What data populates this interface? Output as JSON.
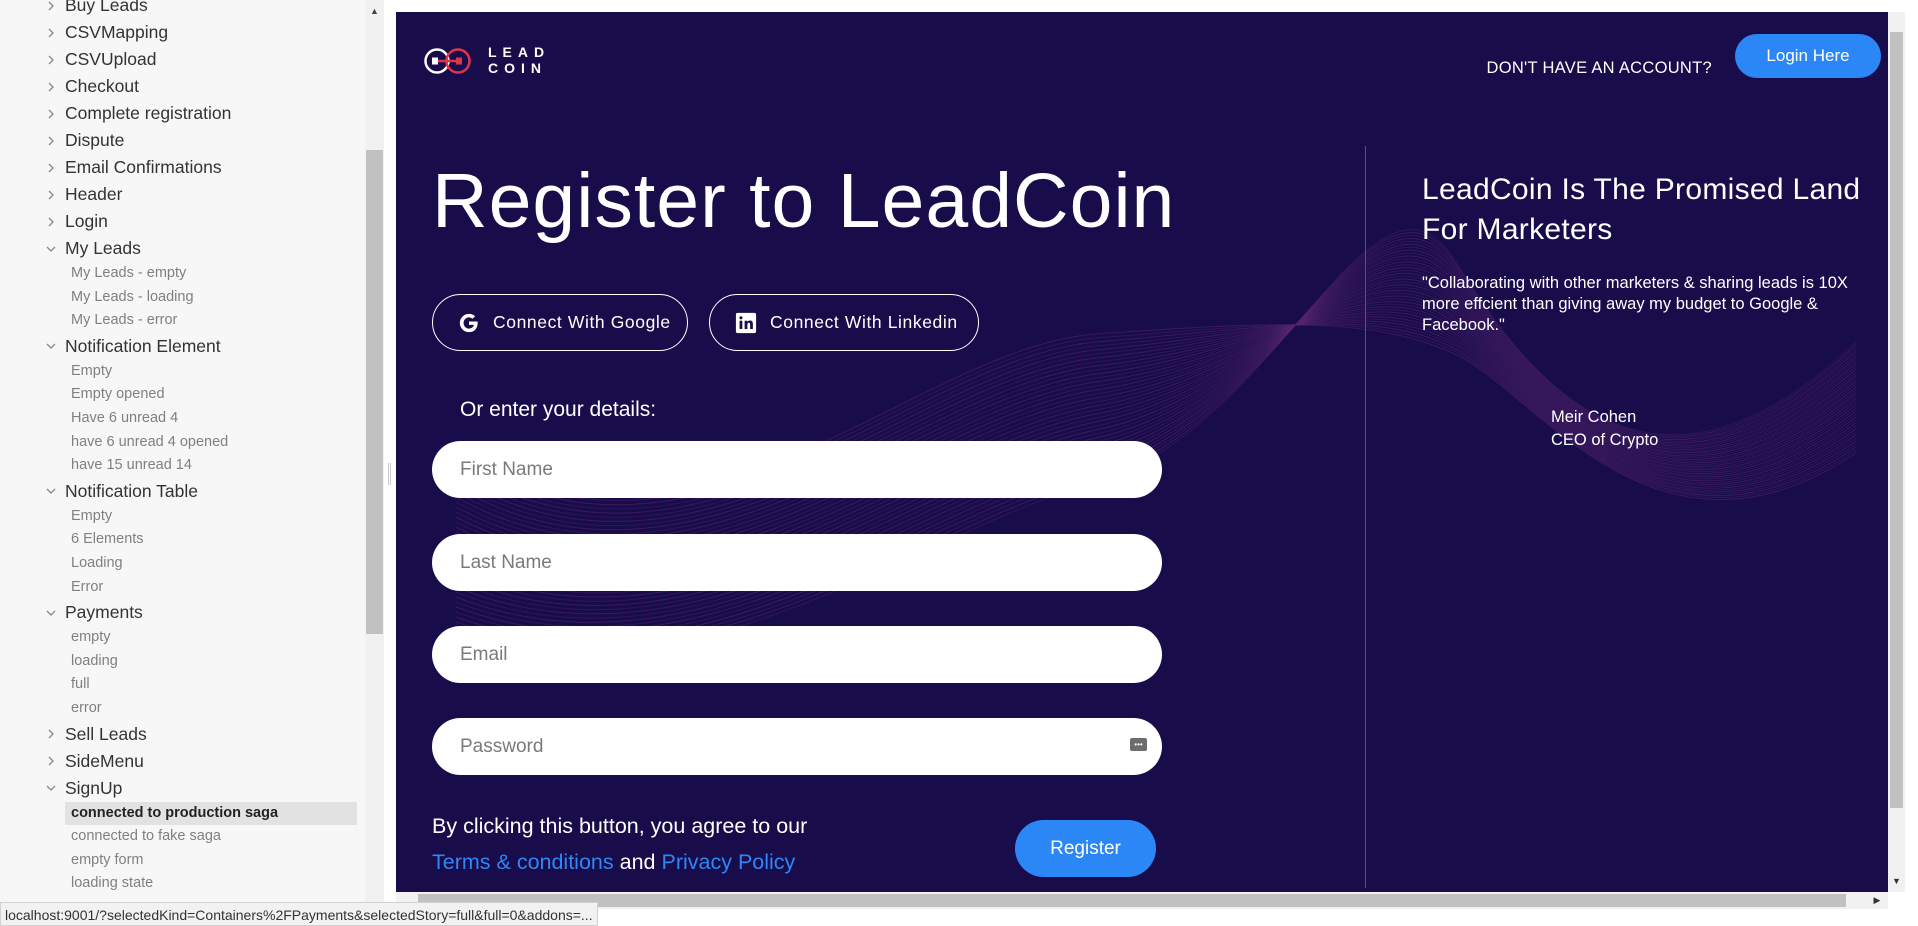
{
  "sidebar": {
    "tree": [
      {
        "label": "Buy Leads",
        "expanded": false
      },
      {
        "label": "CSVMapping",
        "expanded": false
      },
      {
        "label": "CSVUpload",
        "expanded": false
      },
      {
        "label": "Checkout",
        "expanded": false
      },
      {
        "label": "Complete registration",
        "expanded": false
      },
      {
        "label": "Dispute",
        "expanded": false
      },
      {
        "label": "Email Confirmations",
        "expanded": false
      },
      {
        "label": "Header",
        "expanded": false
      },
      {
        "label": "Login",
        "expanded": false
      },
      {
        "label": "My Leads",
        "expanded": true,
        "stories": [
          "My Leads - empty",
          "My Leads - loading",
          "My Leads - error"
        ]
      },
      {
        "label": "Notification Element",
        "expanded": true,
        "stories": [
          "Empty",
          "Empty opened",
          "Have 6 unread 4",
          "have 6 unread 4 opened",
          "have 15 unread 14"
        ]
      },
      {
        "label": "Notification Table",
        "expanded": true,
        "stories": [
          "Empty",
          "6 Elements",
          "Loading",
          "Error"
        ]
      },
      {
        "label": "Payments",
        "expanded": true,
        "stories": [
          "empty",
          "loading",
          "full",
          "error"
        ]
      },
      {
        "label": "Sell Leads",
        "expanded": false
      },
      {
        "label": "SideMenu",
        "expanded": false
      },
      {
        "label": "SignUp",
        "expanded": true,
        "stories": [
          "connected to production saga",
          "connected to fake saga",
          "empty form",
          "loading state"
        ],
        "selected": "connected to production saga"
      }
    ]
  },
  "header": {
    "logo_text_line1": "LEAD",
    "logo_text_line2": "COIN",
    "no_account": "DON'T HAVE AN ACCOUNT?",
    "login_label": "Login Here"
  },
  "register": {
    "title": "Register to LeadCoin",
    "google_label": "Connect With Google",
    "linkedin_label": "Connect With Linkedin",
    "or_details": "Or enter your details:",
    "first_name_placeholder": "First Name",
    "last_name_placeholder": "Last Name",
    "email_placeholder": "Email",
    "password_placeholder": "Password",
    "terms_prefix": "By clicking this button, you agree to our",
    "terms_link": "Terms & conditions",
    "terms_and": "and",
    "privacy_link": "Privacy Policy",
    "register_label": "Register"
  },
  "promo": {
    "title": "LeadCoin Is The Promised Land For Marketers",
    "quote": "\"Collaborating with other marketers & sharing leads is 10X more effcient than giving away my budget to Google & Facebook.\"",
    "name": "Meir Cohen",
    "role": "CEO of Crypto"
  },
  "status_bar": {
    "url": "localhost:9001/?selectedKind=Containers%2FPayments&selectedStory=full&full=0&addons=..."
  },
  "colors": {
    "brand_bg": "#180c4a",
    "accent": "#2b86f6",
    "link": "#2f86f6",
    "logo_red": "#e1344b"
  }
}
